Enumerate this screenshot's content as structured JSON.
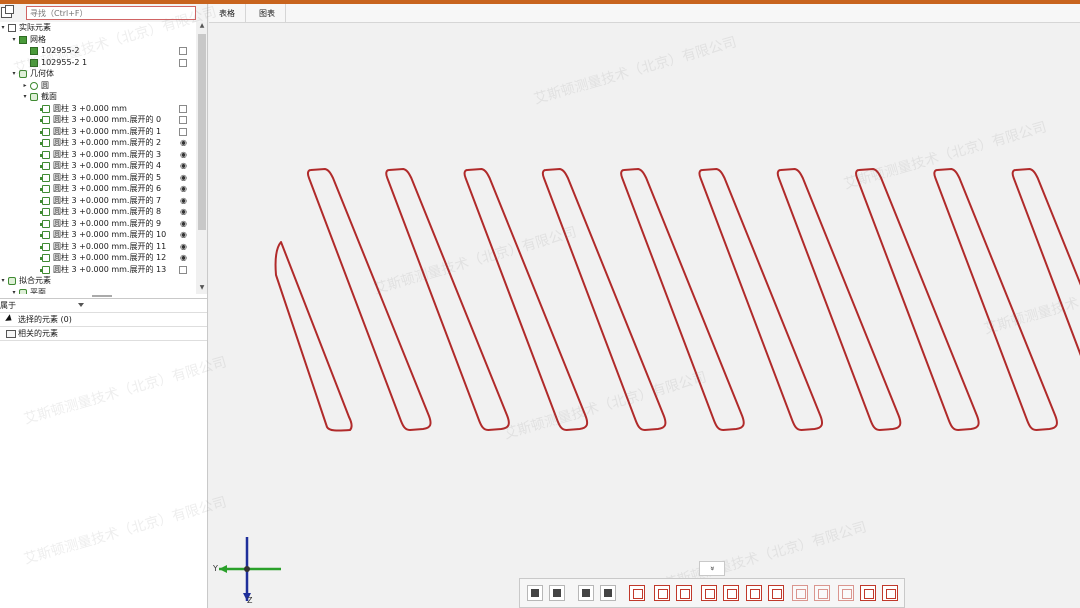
{
  "search": {
    "placeholder": "寻找（Ctrl+F）"
  },
  "tree": [
    {
      "label": "实际元素",
      "level": 0,
      "icon": "fold",
      "toggle": "▾",
      "mark": ""
    },
    {
      "label": "网格",
      "level": 1,
      "icon": "mesh",
      "toggle": "▾",
      "mark": ""
    },
    {
      "label": "102955-2",
      "level": 2,
      "icon": "mesh",
      "toggle": "",
      "mark": "box"
    },
    {
      "label": "102955-2 1",
      "level": 2,
      "icon": "mesh",
      "toggle": "",
      "mark": "box"
    },
    {
      "label": "几何体",
      "level": 1,
      "icon": "geo",
      "toggle": "▾",
      "mark": ""
    },
    {
      "label": "圆",
      "level": 2,
      "icon": "circ",
      "toggle": "▸",
      "mark": ""
    },
    {
      "label": "截面",
      "level": 2,
      "icon": "geo",
      "toggle": "▾",
      "mark": ""
    },
    {
      "label": "圆柱 3 +0.000 mm",
      "level": 3,
      "icon": "cyl",
      "toggle": "",
      "mark": "box"
    },
    {
      "label": "圆柱 3 +0.000 mm.展开的 0",
      "level": 3,
      "icon": "cyl",
      "toggle": "",
      "mark": "box"
    },
    {
      "label": "圆柱 3 +0.000 mm.展开的 1",
      "level": 3,
      "icon": "cyl",
      "toggle": "",
      "mark": "box"
    },
    {
      "label": "圆柱 3 +0.000 mm.展开的 2",
      "level": 3,
      "icon": "cyl",
      "toggle": "",
      "mark": "eye"
    },
    {
      "label": "圆柱 3 +0.000 mm.展开的 3",
      "level": 3,
      "icon": "cyl",
      "toggle": "",
      "mark": "eye"
    },
    {
      "label": "圆柱 3 +0.000 mm.展开的 4",
      "level": 3,
      "icon": "cyl",
      "toggle": "",
      "mark": "eye"
    },
    {
      "label": "圆柱 3 +0.000 mm.展开的 5",
      "level": 3,
      "icon": "cyl",
      "toggle": "",
      "mark": "eye"
    },
    {
      "label": "圆柱 3 +0.000 mm.展开的 6",
      "level": 3,
      "icon": "cyl",
      "toggle": "",
      "mark": "eye"
    },
    {
      "label": "圆柱 3 +0.000 mm.展开的 7",
      "level": 3,
      "icon": "cyl",
      "toggle": "",
      "mark": "eye"
    },
    {
      "label": "圆柱 3 +0.000 mm.展开的 8",
      "level": 3,
      "icon": "cyl",
      "toggle": "",
      "mark": "eye"
    },
    {
      "label": "圆柱 3 +0.000 mm.展开的 9",
      "level": 3,
      "icon": "cyl",
      "toggle": "",
      "mark": "eye"
    },
    {
      "label": "圆柱 3 +0.000 mm.展开的 10",
      "level": 3,
      "icon": "cyl",
      "toggle": "",
      "mark": "eye"
    },
    {
      "label": "圆柱 3 +0.000 mm.展开的 11",
      "level": 3,
      "icon": "cyl",
      "toggle": "",
      "mark": "eye"
    },
    {
      "label": "圆柱 3 +0.000 mm.展开的 12",
      "level": 3,
      "icon": "cyl",
      "toggle": "",
      "mark": "eye"
    },
    {
      "label": "圆柱 3 +0.000 mm.展开的 13",
      "level": 3,
      "icon": "cyl",
      "toggle": "",
      "mark": "box"
    },
    {
      "label": "拟合元素",
      "level": 0,
      "icon": "geo",
      "toggle": "▾",
      "mark": ""
    },
    {
      "label": "平面",
      "level": 1,
      "icon": "geo",
      "toggle": "▾",
      "mark": ""
    }
  ],
  "props": {
    "belongs_label": "属于",
    "selected_label": "选择的元素 (0)",
    "related_label": "相关的元素"
  },
  "collapse_label": "«",
  "tabs": [
    "表格",
    "图表"
  ],
  "expand_label": "»",
  "axis": {
    "y_label": "Y",
    "z_label": "Z"
  },
  "watermark": "艾斯顿测量技术（北京）有限公司",
  "colors": {
    "accent_bar": "#c8641e",
    "section_curve": "#b02a2a",
    "axis_y": "#2aa02a",
    "axis_z": "#1f2f9a"
  },
  "toolbar_icons": [
    "view-icon",
    "section-icon",
    "select-icon",
    "compare-icon",
    "point-icon",
    "gauge-icon",
    "align-icon",
    "frame-icon",
    "deviation-icon",
    "angle-icon",
    "link-icon",
    "fit-icon",
    "zoom-icon",
    "report-icon",
    "snapshot-icon",
    "settings-icon"
  ]
}
